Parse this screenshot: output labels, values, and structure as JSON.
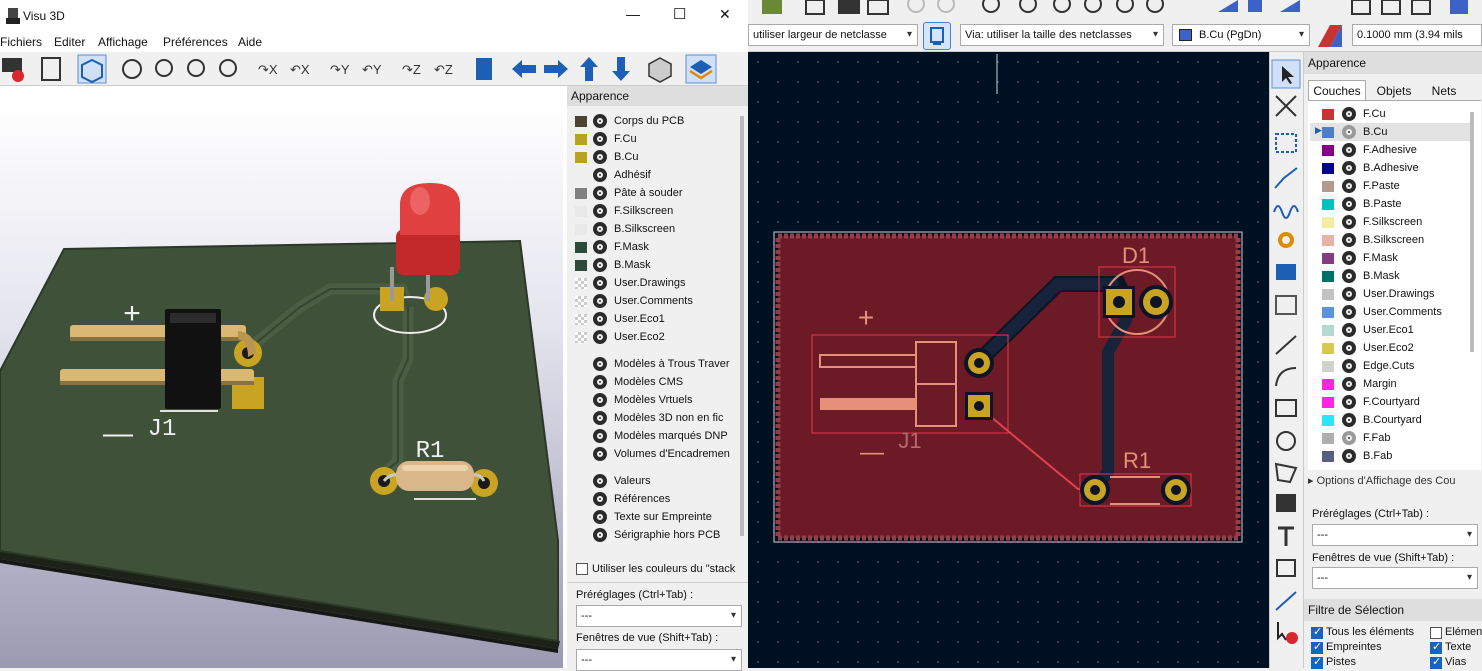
{
  "v3d": {
    "title": "Visu 3D",
    "win_min": "—",
    "win_max": "☐",
    "win_close": "✕",
    "menu": [
      "Fichiers",
      "Editer",
      "Affichage",
      "Préférences",
      "Aide"
    ],
    "board_labels": {
      "plus": "+",
      "minus": "—",
      "j1": "J1",
      "r1": "R1"
    },
    "panel": {
      "header": "Apparence",
      "layers": [
        {
          "name": "Corps du PCB",
          "color": "#4a4431"
        },
        {
          "name": "F.Cu",
          "color": "#b8a224"
        },
        {
          "name": "B.Cu",
          "color": "#b8a224"
        },
        {
          "name": "Adhésif",
          "color": ""
        },
        {
          "name": "Pâte à souder",
          "color": "#808080"
        },
        {
          "name": "F.Silkscreen",
          "color": "#e8e8e8"
        },
        {
          "name": "B.Silkscreen",
          "color": "#e8e8e8"
        },
        {
          "name": "F.Mask",
          "color": "#2e4a3c"
        },
        {
          "name": "B.Mask",
          "color": "#2e4a3c"
        },
        {
          "name": "User.Drawings",
          "color": "checker"
        },
        {
          "name": "User.Comments",
          "color": "checker"
        },
        {
          "name": "User.Eco1",
          "color": "checker"
        },
        {
          "name": "User.Eco2",
          "color": "checker"
        }
      ],
      "models": [
        "Modèles à Trous Traver",
        "Modèles CMS",
        "Modèles Vrtuels",
        "Modèles 3D non en fic",
        "Modèles marqués DNP",
        "Volumes d'Encadremen"
      ],
      "texts": [
        "Valeurs",
        "Références",
        "Texte sur Empreinte",
        "Sérigraphie hors PCB"
      ],
      "stackup_checkbox": "Utiliser les couleurs du \"stack",
      "presets_label": "Préréglages (Ctrl+Tab) :",
      "presets_value": "---",
      "viewports_label": "Fenêtres de vue (Shift+Tab) :",
      "viewports_value": "---"
    }
  },
  "pcb": {
    "toolbar": {
      "track_width": "utiliser largeur de netclasse",
      "via_size": "Via: utiliser la taille des netclasses",
      "active_layer": "B.Cu (PgDn)",
      "active_layer_color": "#3c62c8",
      "grid": "0.1000 mm (3.94 mils"
    },
    "canvas_labels": {
      "d1": "D1",
      "r1": "R1",
      "j1": "J1",
      "plus": "+",
      "minus": "—"
    },
    "appearance": {
      "header": "Apparence",
      "tabs": [
        "Couches",
        "Objets",
        "Nets"
      ],
      "layers": [
        {
          "name": "F.Cu",
          "color": "#c83434",
          "hidden": false
        },
        {
          "name": "B.Cu",
          "color": "#4d7fc4",
          "hidden": true
        },
        {
          "name": "F.Adhesive",
          "color": "#84008a",
          "hidden": false
        },
        {
          "name": "B.Adhesive",
          "color": "#00008a",
          "hidden": false
        },
        {
          "name": "F.Paste",
          "color": "#b49a8e",
          "hidden": false
        },
        {
          "name": "B.Paste",
          "color": "#00c2c2",
          "hidden": false
        },
        {
          "name": "F.Silkscreen",
          "color": "#f2eda1",
          "hidden": false
        },
        {
          "name": "B.Silkscreen",
          "color": "#e8b2a7",
          "hidden": false
        },
        {
          "name": "F.Mask",
          "color": "#843b84",
          "hidden": false
        },
        {
          "name": "B.Mask",
          "color": "#02706a",
          "hidden": false
        },
        {
          "name": "User.Drawings",
          "color": "#c2c2c2",
          "hidden": false
        },
        {
          "name": "User.Comments",
          "color": "#5994dc",
          "hidden": false
        },
        {
          "name": "User.Eco1",
          "color": "#b4dbd2",
          "hidden": false
        },
        {
          "name": "User.Eco2",
          "color": "#d8c852",
          "hidden": false
        },
        {
          "name": "Edge.Cuts",
          "color": "#d0d2cd",
          "hidden": false
        },
        {
          "name": "Margin",
          "color": "#ff26e2",
          "hidden": false
        },
        {
          "name": "F.Courtyard",
          "color": "#ff26e2",
          "hidden": false
        },
        {
          "name": "B.Courtyard",
          "color": "#26e9ff",
          "hidden": false
        },
        {
          "name": "F.Fab",
          "color": "#afafaf",
          "hidden": true
        },
        {
          "name": "B.Fab",
          "color": "#585d84",
          "hidden": false
        }
      ],
      "options_label": "Options d'Affichage des Cou",
      "presets_label": "Préréglages (Ctrl+Tab) :",
      "presets_value": "---",
      "viewports_label": "Fenêtres de vue (Shift+Tab) :",
      "viewports_value": "---",
      "selection_filter": {
        "header": "Filtre de Sélection",
        "items": [
          "Tous les éléments",
          "Elément",
          "Empreintes",
          "Texte",
          "Pistes",
          "Vias"
        ]
      }
    }
  }
}
